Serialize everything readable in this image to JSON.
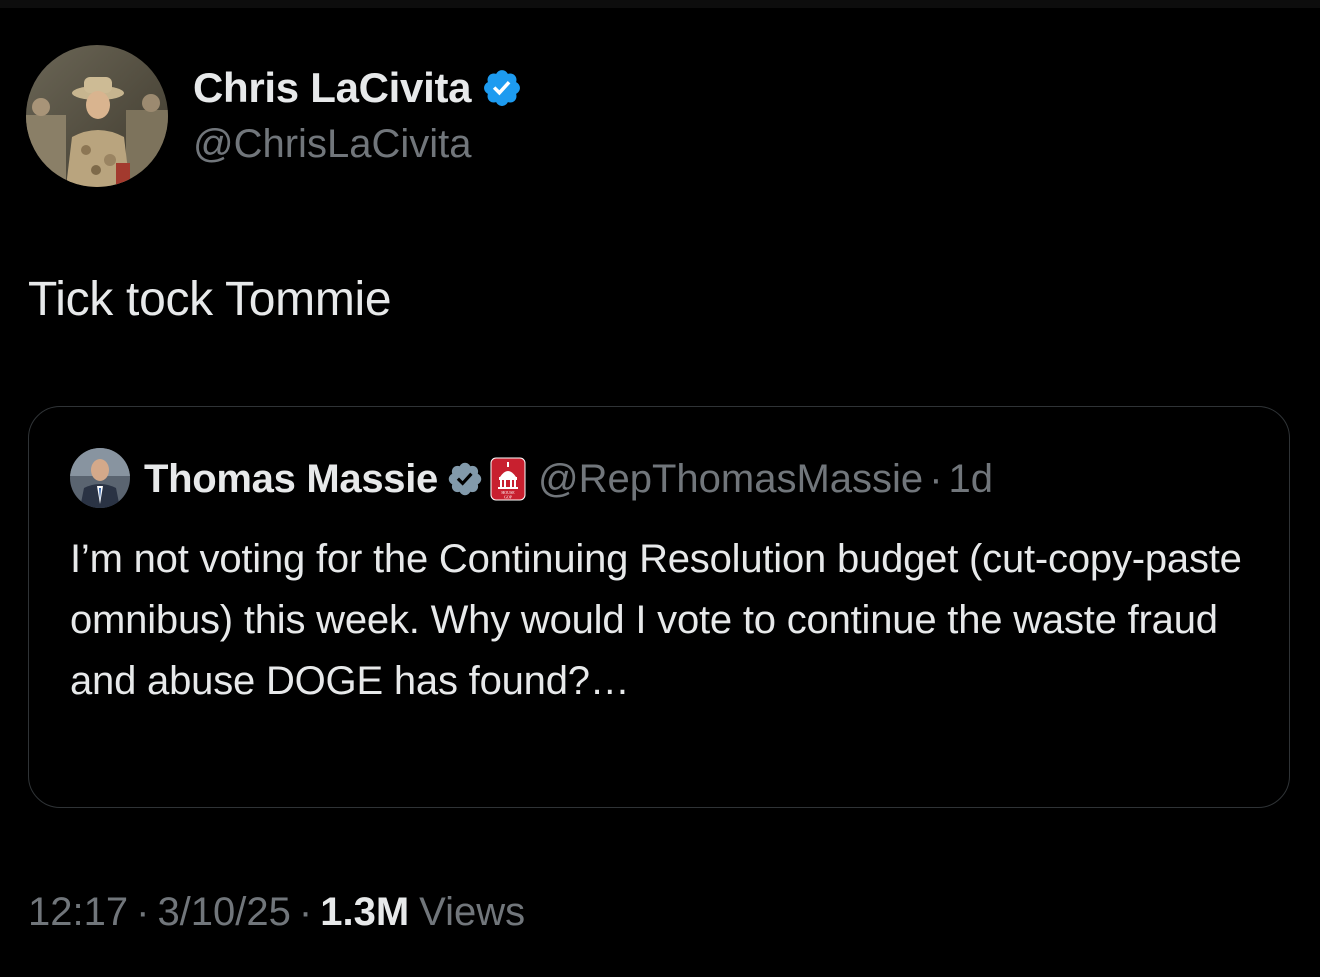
{
  "author": {
    "display_name": "Chris LaCivita",
    "handle": "@ChrisLaCivita",
    "verified": true,
    "avatar_icon": "profile-photo-military"
  },
  "tweet": {
    "text": "Tick tock Tommie"
  },
  "quoted_tweet": {
    "display_name": "Thomas Massie",
    "handle": "@RepThomasMassie",
    "separator": "·",
    "time_ago": "1d",
    "verified": true,
    "affiliation_badge_text": "HOUSE GOP",
    "text": "I’m not voting for the Continuing Resolution budget (cut-copy-paste omnibus) this week. Why would I vote to continue the waste fraud and abuse DOGE has found?…"
  },
  "meta": {
    "time": "12:17",
    "separator": "·",
    "date": "3/10/25",
    "views_count": "1.3M",
    "views_label": "Views"
  },
  "colors": {
    "background": "#000000",
    "primary_text": "#e7e9ea",
    "secondary_text": "#71767b",
    "verified_blue": "#1d9bf0",
    "verified_grey": "#829aab",
    "badge_red": "#c8202f",
    "border": "#2f3336"
  }
}
